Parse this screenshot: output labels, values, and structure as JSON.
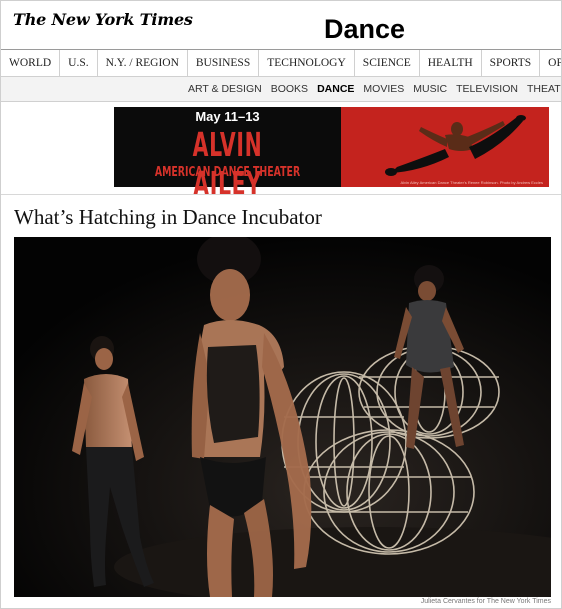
{
  "masthead": {
    "logo_text": "The New York Times",
    "section": "Dance"
  },
  "nav_primary": [
    "WORLD",
    "U.S.",
    "N.Y. / REGION",
    "BUSINESS",
    "TECHNOLOGY",
    "SCIENCE",
    "HEALTH",
    "SPORTS",
    "OPINION"
  ],
  "nav_secondary": {
    "items": [
      "ART & DESIGN",
      "BOOKS",
      "DANCE",
      "MOVIES",
      "MUSIC",
      "TELEVISION",
      "THEATER"
    ],
    "active": "DANCE"
  },
  "ad": {
    "date": "May 11–13",
    "name": "ALVIN AILEY",
    "subtitle": "AMERICAN DANCE THEATER",
    "fine_print": "Alvin Ailey American Dance Theater's Renee Robinson. Photo by Andrew Eccles",
    "colors": {
      "left_bg": "#0b0b0b",
      "right_bg": "#c4231e",
      "title": "#d6322a"
    }
  },
  "article": {
    "headline": "What’s Hatching in Dance Incubator",
    "photo_credit": "Julieta Cervantes for The New York Times"
  }
}
